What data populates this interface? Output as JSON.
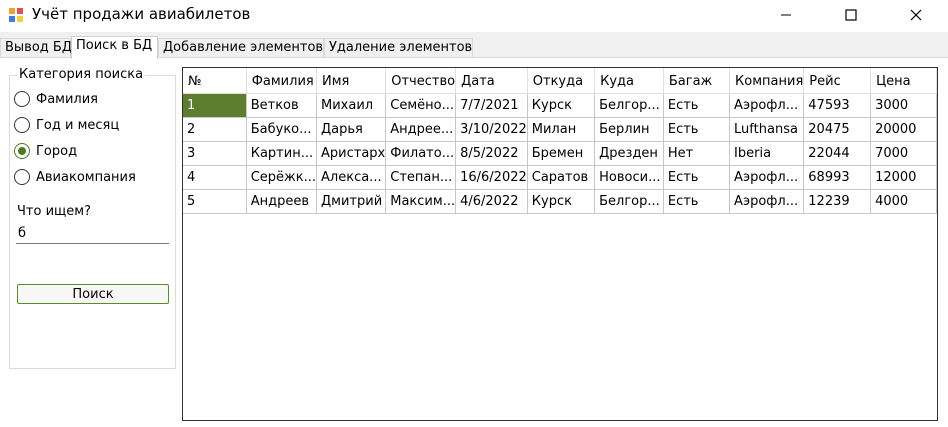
{
  "window": {
    "title": "Учёт продажи авиабилетов",
    "icon": "app-icon"
  },
  "tabs": [
    {
      "label": "Вывод БД",
      "active": false
    },
    {
      "label": "Поиск в БД",
      "active": true
    },
    {
      "label": "Добавление элементов",
      "active": false
    },
    {
      "label": "Удаление элементов",
      "active": false
    }
  ],
  "search_panel": {
    "group_title": "Категория поиска",
    "options": [
      "Фамилия",
      "Год и месяц",
      "Город",
      "Авиакомпания"
    ],
    "selected_option": "Город",
    "query_label": "Что ищем?",
    "query_value": "б",
    "button_label": "Поиск"
  },
  "grid": {
    "columns": [
      "№",
      "Фамилия",
      "Имя",
      "Отчество",
      "Дата",
      "Откуда",
      "Куда",
      "Багаж",
      "Компания",
      "Рейс",
      "Цена"
    ],
    "rows": [
      [
        "1",
        "Ветков",
        "Михаил",
        "Семёно...",
        "7/7/2021",
        "Курск",
        "Белгор...",
        "Есть",
        "Аэрофл...",
        "47593",
        "3000"
      ],
      [
        "2",
        "Бабуко...",
        "Дарья",
        "Андрее...",
        "3/10/2022",
        "Милан",
        "Берлин",
        "Есть",
        "Lufthansa",
        "20475",
        "20000"
      ],
      [
        "3",
        "Картин...",
        "Аристарх",
        "Филато...",
        "8/5/2022",
        "Бремен",
        "Дрезден",
        "Нет",
        "Iberia",
        "22044",
        "7000"
      ],
      [
        "4",
        "Серёжк...",
        "Алекса...",
        "Степан...",
        "16/6/2022",
        "Саратов",
        "Новоси...",
        "Есть",
        "Аэрофл...",
        "68993",
        "12000"
      ],
      [
        "5",
        "Андреев",
        "Дмитрий",
        "Максим...",
        "4/6/2022",
        "Курск",
        "Белгор...",
        "Есть",
        "Аэрофл...",
        "12239",
        "4000"
      ]
    ],
    "selected_cell_color": "#5e7d2e"
  },
  "colors": {
    "accent": "#5e7d2e",
    "radio_selected": "#4f7a22"
  }
}
